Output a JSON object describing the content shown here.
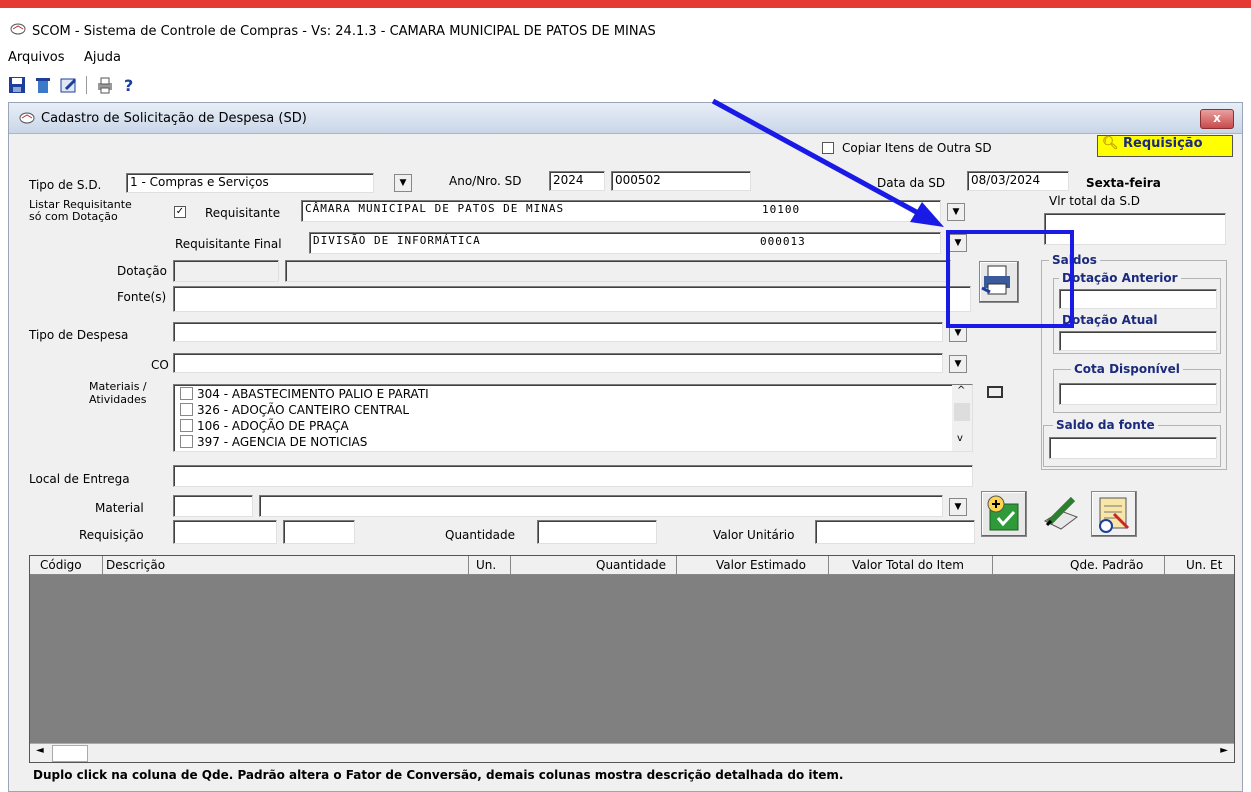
{
  "app": {
    "title": "SCOM - Sistema de Controle de Compras - Vs: 24.1.3 - CAMARA MUNICIPAL DE PATOS DE MINAS"
  },
  "menu": {
    "items": [
      "Arquivos",
      "Ajuda"
    ]
  },
  "window": {
    "title": "Cadastro de Solicitação de Despesa (SD)",
    "close_label": "x"
  },
  "top": {
    "copiar_label": "Copiar Itens de  Outra SD",
    "requisicao_label": "Requisição"
  },
  "form": {
    "tipo_sd_label": "Tipo de S.D.",
    "tipo_sd_value": "1 - Compras e Serviços",
    "ano_nro_label": "Ano/Nro. SD",
    "ano_value": "2024",
    "nro_value": "000502",
    "data_sd_label": "Data da SD",
    "data_sd_value": "08/03/2024",
    "dia_semana": "Sexta-feira",
    "vlr_total_label": "Vlr total da S.D",
    "listar_label_1": "Listar Requisitante",
    "listar_label_2": "só com Dotação",
    "requisitante_label": "Requisitante",
    "requisitante_value": "CÂMARA MUNICIPAL DE PATOS DE MINAS",
    "requisitante_code": "10100",
    "req_final_label": "Requisitante Final",
    "req_final_value": "DIVISÃO DE INFORMÁTICA",
    "req_final_code": "000013",
    "dotacao_label": "Dotação",
    "fontes_label": "Fonte(s)",
    "tipo_despesa_label": "Tipo de Despesa",
    "co_label": "CO",
    "materiais_label_1": "Materiais /",
    "materiais_label_2": "Atividades",
    "local_entrega_label": "Local de Entrega",
    "material_label": "Material",
    "requisicao_field_label": "Requisição",
    "quantidade_label": "Quantidade",
    "valor_unitario_label": "Valor Unitário"
  },
  "materiais": [
    "304 - ABASTECIMENTO PALIO E PARATI",
    "326 - ADOÇÃO CANTEIRO CENTRAL",
    "106 - ADOÇÃO DE PRAÇA",
    "397 - AGENCIA DE NOTICIAS"
  ],
  "saldos": {
    "title": "Saldos",
    "dotacao_anterior": "Dotação Anterior",
    "dotacao_atual": "Dotação Atual",
    "cota_disponivel": "Cota Disponível",
    "saldo_fonte": "Saldo da fonte"
  },
  "grid": {
    "columns": [
      "Código",
      "Descrição",
      "Un.",
      "Quantidade",
      "Valor Estimado",
      "Valor Total do Item",
      "Qde. Padrão",
      "Un. Et"
    ]
  },
  "status": {
    "text": "Duplo click na coluna de Qde. Padrão altera o Fator de Conversão, demais colunas mostra descrição detalhada do item."
  },
  "annotation": {
    "color": "#1a1ae6"
  }
}
